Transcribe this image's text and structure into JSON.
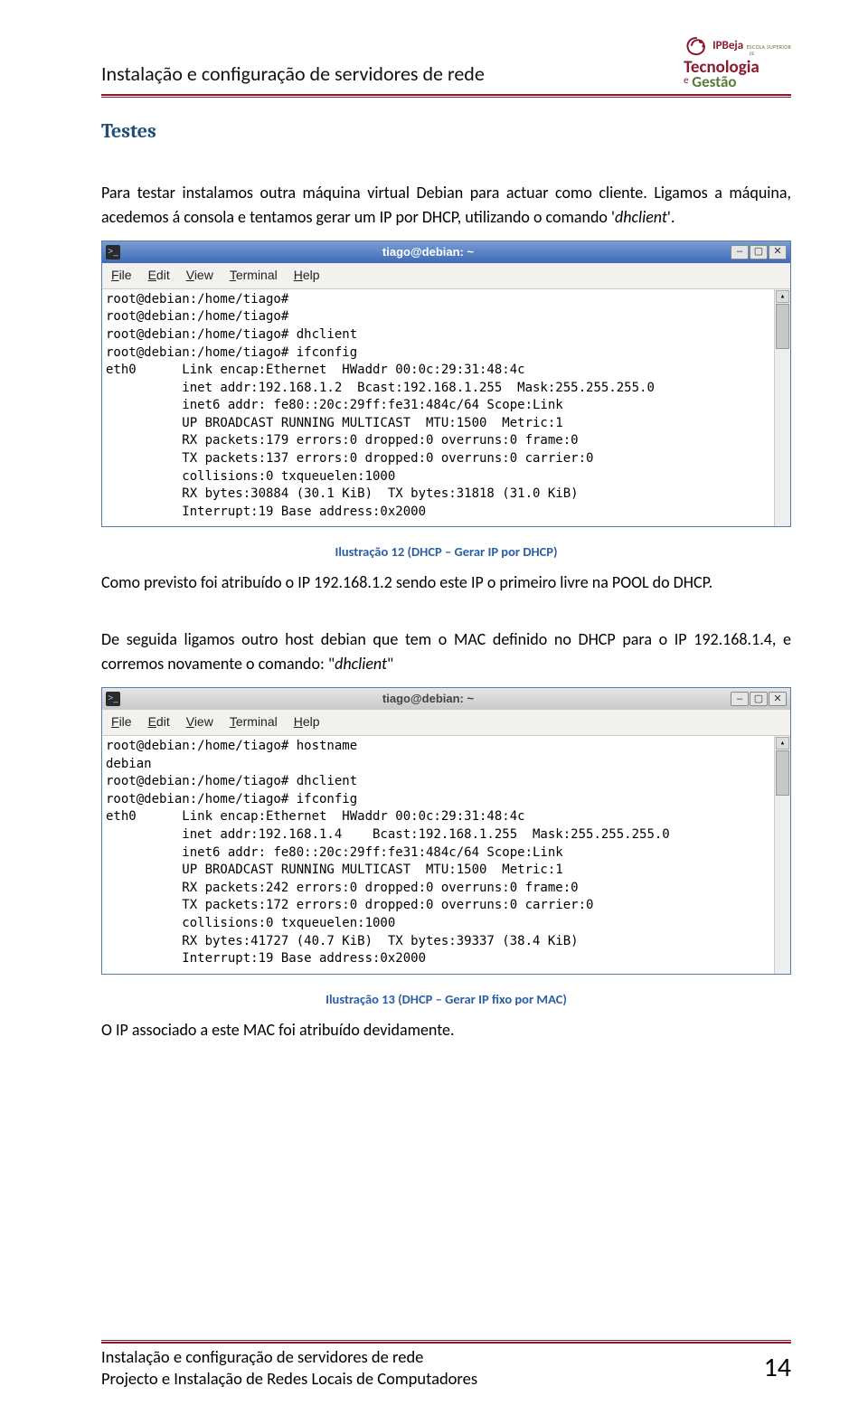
{
  "header": {
    "title": "Instalação e configuração de servidores de rede",
    "logo": {
      "brand": "IPBeja",
      "escola": "ESCOLA SUPERIOR",
      "de": "DE",
      "line1": "Tecnologia",
      "amp": "e",
      "line2": "Gestão"
    }
  },
  "section_title": "Testes",
  "para1": "Para testar instalamos outra máquina virtual Debian para actuar como cliente. Ligamos a máquina, acedemos á consola e tentamos gerar um IP por DHCP, utilizando o comando '",
  "para1_cmd": "dhclient",
  "para1_end": "'.",
  "terminal1": {
    "title": "tiago@debian: ~",
    "menu": {
      "file": "File",
      "edit": "Edit",
      "view": "View",
      "terminal": "Terminal",
      "help": "Help"
    },
    "content": "root@debian:/home/tiago#\nroot@debian:/home/tiago#\nroot@debian:/home/tiago# dhclient\nroot@debian:/home/tiago# ifconfig\neth0      Link encap:Ethernet  HWaddr 00:0c:29:31:48:4c\n          inet addr:192.168.1.2  Bcast:192.168.1.255  Mask:255.255.255.0\n          inet6 addr: fe80::20c:29ff:fe31:484c/64 Scope:Link\n          UP BROADCAST RUNNING MULTICAST  MTU:1500  Metric:1\n          RX packets:179 errors:0 dropped:0 overruns:0 frame:0\n          TX packets:137 errors:0 dropped:0 overruns:0 carrier:0\n          collisions:0 txqueuelen:1000\n          RX bytes:30884 (30.1 KiB)  TX bytes:31818 (31.0 KiB)\n          Interrupt:19 Base address:0x2000"
  },
  "caption1": "Ilustração 12 (DHCP – Gerar IP por DHCP)",
  "para2": "Como previsto foi atribuído o IP 192.168.1.2 sendo este IP o primeiro livre na POOL do DHCP.",
  "para3a": "De seguida ligamos outro host debian que tem o MAC definido no DHCP para o IP 192.168.1.4, e corremos novamente o comando: \"",
  "para3_cmd": "dhclient",
  "para3b": "\"",
  "terminal2": {
    "title": "tiago@debian: ~",
    "menu": {
      "file": "File",
      "edit": "Edit",
      "view": "View",
      "terminal": "Terminal",
      "help": "Help"
    },
    "content": "root@debian:/home/tiago# hostname\ndebian\nroot@debian:/home/tiago# dhclient\nroot@debian:/home/tiago# ifconfig\neth0      Link encap:Ethernet  HWaddr 00:0c:29:31:48:4c\n          inet addr:192.168.1.4    Bcast:192.168.1.255  Mask:255.255.255.0\n          inet6 addr: fe80::20c:29ff:fe31:484c/64 Scope:Link\n          UP BROADCAST RUNNING MULTICAST  MTU:1500  Metric:1\n          RX packets:242 errors:0 dropped:0 overruns:0 frame:0\n          TX packets:172 errors:0 dropped:0 overruns:0 carrier:0\n          collisions:0 txqueuelen:1000\n          RX bytes:41727 (40.7 KiB)  TX bytes:39337 (38.4 KiB)\n          Interrupt:19 Base address:0x2000"
  },
  "caption2": "Ilustração 13 (DHCP – Gerar IP fixo por MAC)",
  "para4": "O IP associado a este MAC foi atribuído devidamente.",
  "footer": {
    "line1": "Instalação e configuração de servidores de rede",
    "line2": "Projecto e Instalação de Redes Locais de Computadores",
    "page": "14"
  },
  "glyphs": {
    "min": "–",
    "max": "▢",
    "close": "✕",
    "up": "▴"
  }
}
